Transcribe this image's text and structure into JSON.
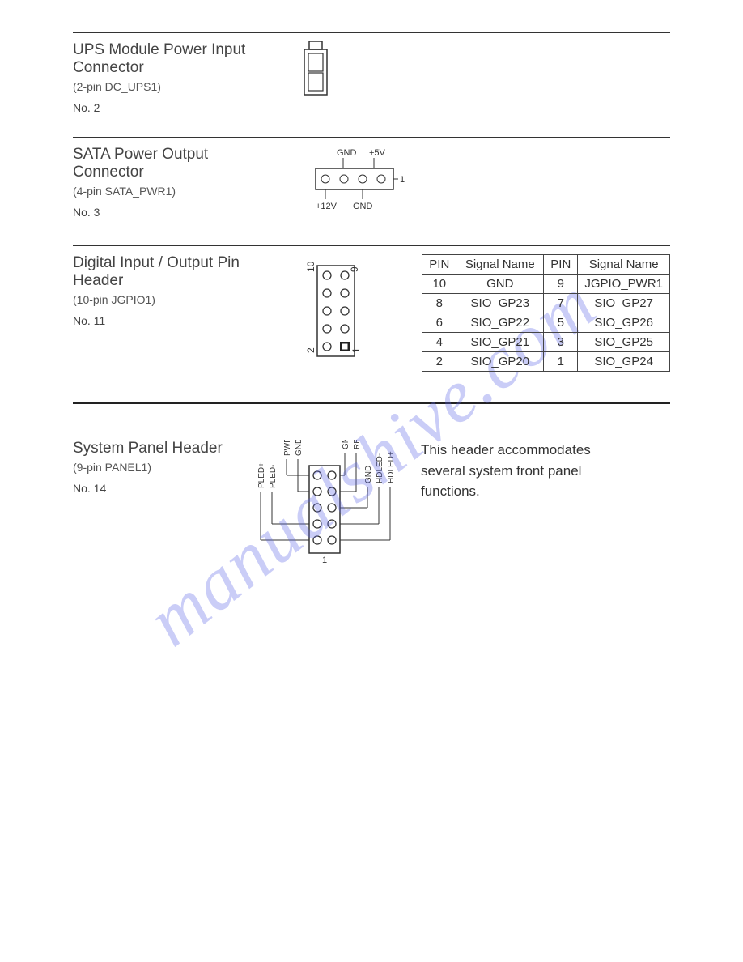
{
  "watermark": "manualshive.com",
  "sections": {
    "ups": {
      "title": "UPS Module Power Input Connector",
      "sub": "(2-pin DC_UPS1)",
      "no": "No. 2"
    },
    "sata": {
      "title": "SATA Power Output Connector",
      "sub": "(4-pin SATA_PWR1)",
      "no": "No. 3",
      "labels": {
        "tl": "GND",
        "tr": "+5V",
        "bl": "+12V",
        "br": "GND",
        "pin1": "1"
      }
    },
    "gpio": {
      "title": "Digital Input / Output Pin Header",
      "sub": "(10-pin JGPIO1)",
      "no": "No. 11",
      "diagram_labels": {
        "tl": "10",
        "tr": "9",
        "bl": "2",
        "br": "1"
      },
      "table": {
        "headers": [
          "PIN",
          "Signal Name",
          "PIN",
          "Signal Name"
        ],
        "rows": [
          [
            "10",
            "GND",
            "9",
            "JGPIO_PWR1"
          ],
          [
            "8",
            "SIO_GP23",
            "7",
            "SIO_GP27"
          ],
          [
            "6",
            "SIO_GP22",
            "5",
            "SIO_GP26"
          ],
          [
            "4",
            "SIO_GP21",
            "3",
            "SIO_GP25"
          ],
          [
            "2",
            "SIO_GP20",
            "1",
            "SIO_GP24"
          ]
        ]
      }
    },
    "panel": {
      "title": "System Panel Header",
      "sub": "(9-pin PANEL1)",
      "no": "No. 14",
      "desc": "This header accommodates several system front panel functions.",
      "labels": {
        "left": [
          "PWRBTN#",
          "GND",
          "PLED-",
          "PLED+"
        ],
        "right": [
          "GND",
          "RESET#",
          "GND",
          "HDLED-",
          "HDLED+"
        ],
        "pin1": "1"
      }
    }
  }
}
